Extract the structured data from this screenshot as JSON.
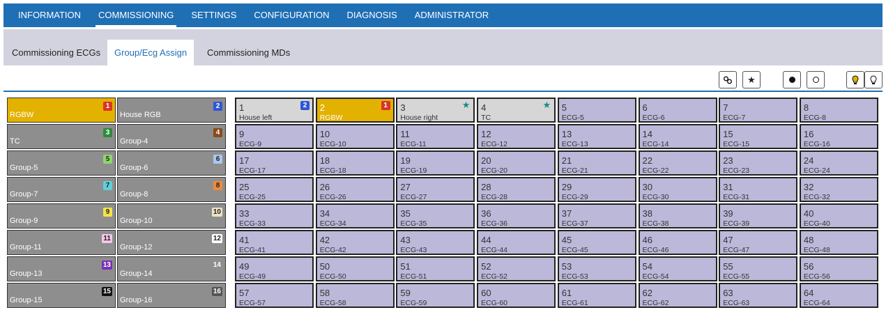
{
  "nav": {
    "items": [
      "INFORMATION",
      "COMMISSIONING",
      "SETTINGS",
      "CONFIGURATION",
      "DIAGNOSIS",
      "ADMINISTRATOR"
    ],
    "active": "COMMISSIONING"
  },
  "subtabs": {
    "items": [
      "Commissioning ECGs",
      "Group/Ecg Assign",
      "Commissioning MDs"
    ],
    "active": "Group/Ecg Assign"
  },
  "toolbar": {
    "buttons": [
      "link-icon",
      "star-icon",
      "filled-circle-icon",
      "hollow-circle-icon",
      "bulb-on-icon",
      "bulb-off-icon"
    ]
  },
  "groups": [
    {
      "label": "RGBW",
      "num": "1",
      "color": "#d9342b",
      "text_color": "#ffffff",
      "selected": true
    },
    {
      "label": "House RGB",
      "num": "2",
      "color": "#2f56d6",
      "text_color": "#ffffff"
    },
    {
      "label": "TC",
      "num": "3",
      "color": "#2e8b3a",
      "text_color": "#ffffff"
    },
    {
      "label": "Group-4",
      "num": "4",
      "color": "#8b4a1c",
      "text_color": "#ffffff"
    },
    {
      "label": "Group-5",
      "num": "5",
      "color": "#8fd66a",
      "text_color": "#222222"
    },
    {
      "label": "Group-6",
      "num": "6",
      "color": "#a9c8f0",
      "text_color": "#222222"
    },
    {
      "label": "Group-7",
      "num": "7",
      "color": "#5fd0d8",
      "text_color": "#222222"
    },
    {
      "label": "Group-8",
      "num": "8",
      "color": "#f08a3a",
      "text_color": "#222222"
    },
    {
      "label": "Group-9",
      "num": "9",
      "color": "#f5e24a",
      "text_color": "#222222"
    },
    {
      "label": "Group-10",
      "num": "10",
      "color": "#ede4c4",
      "text_color": "#222222"
    },
    {
      "label": "Group-11",
      "num": "11",
      "color": "#f3c6e6",
      "text_color": "#222222"
    },
    {
      "label": "Group-12",
      "num": "12",
      "color": "#ffffff",
      "text_color": "#222222"
    },
    {
      "label": "Group-13",
      "num": "13",
      "color": "#7a2fb8",
      "text_color": "#ffffff"
    },
    {
      "label": "Group-14",
      "num": "14",
      "color": "#8e8e8e",
      "text_color": "#ffffff"
    },
    {
      "label": "Group-15",
      "num": "15",
      "color": "#111111",
      "text_color": "#ffffff"
    },
    {
      "label": "Group-16",
      "num": "16",
      "color": "#555555",
      "text_color": "#ffffff"
    }
  ],
  "ecgs": [
    {
      "num": "1",
      "name": "House left",
      "badge": "2",
      "badge_color": "#2f56d6",
      "state": "named"
    },
    {
      "num": "2",
      "name": "RGBW",
      "badge": "1",
      "badge_color": "#d9342b",
      "state": "selected"
    },
    {
      "num": "3",
      "name": "House right",
      "star": true,
      "state": "named"
    },
    {
      "num": "4",
      "name": "TC",
      "star": true,
      "state": "named"
    },
    {
      "num": "5",
      "name": "ECG-5"
    },
    {
      "num": "6",
      "name": "ECG-6"
    },
    {
      "num": "7",
      "name": "ECG-7"
    },
    {
      "num": "8",
      "name": "ECG-8"
    },
    {
      "num": "9",
      "name": "ECG-9"
    },
    {
      "num": "10",
      "name": "ECG-10"
    },
    {
      "num": "11",
      "name": "ECG-11"
    },
    {
      "num": "12",
      "name": "ECG-12"
    },
    {
      "num": "13",
      "name": "ECG-13"
    },
    {
      "num": "14",
      "name": "ECG-14"
    },
    {
      "num": "15",
      "name": "ECG-15"
    },
    {
      "num": "16",
      "name": "ECG-16"
    },
    {
      "num": "17",
      "name": "ECG-17"
    },
    {
      "num": "18",
      "name": "ECG-18"
    },
    {
      "num": "19",
      "name": "ECG-19"
    },
    {
      "num": "20",
      "name": "ECG-20"
    },
    {
      "num": "21",
      "name": "ECG-21"
    },
    {
      "num": "22",
      "name": "ECG-22"
    },
    {
      "num": "23",
      "name": "ECG-23"
    },
    {
      "num": "24",
      "name": "ECG-24"
    },
    {
      "num": "25",
      "name": "ECG-25"
    },
    {
      "num": "26",
      "name": "ECG-26"
    },
    {
      "num": "27",
      "name": "ECG-27"
    },
    {
      "num": "28",
      "name": "ECG-28"
    },
    {
      "num": "29",
      "name": "ECG-29"
    },
    {
      "num": "30",
      "name": "ECG-30"
    },
    {
      "num": "31",
      "name": "ECG-31"
    },
    {
      "num": "32",
      "name": "ECG-32"
    },
    {
      "num": "33",
      "name": "ECG-33"
    },
    {
      "num": "34",
      "name": "ECG-34"
    },
    {
      "num": "35",
      "name": "ECG-35"
    },
    {
      "num": "36",
      "name": "ECG-36"
    },
    {
      "num": "37",
      "name": "ECG-37"
    },
    {
      "num": "38",
      "name": "ECG-38"
    },
    {
      "num": "39",
      "name": "ECG-39"
    },
    {
      "num": "40",
      "name": "ECG-40"
    },
    {
      "num": "41",
      "name": "ECG-41"
    },
    {
      "num": "42",
      "name": "ECG-42"
    },
    {
      "num": "43",
      "name": "ECG-43"
    },
    {
      "num": "44",
      "name": "ECG-44"
    },
    {
      "num": "45",
      "name": "ECG-45"
    },
    {
      "num": "46",
      "name": "ECG-46"
    },
    {
      "num": "47",
      "name": "ECG-47"
    },
    {
      "num": "48",
      "name": "ECG-48"
    },
    {
      "num": "49",
      "name": "ECG-49"
    },
    {
      "num": "50",
      "name": "ECG-50"
    },
    {
      "num": "51",
      "name": "ECG-51"
    },
    {
      "num": "52",
      "name": "ECG-52"
    },
    {
      "num": "53",
      "name": "ECG-53"
    },
    {
      "num": "54",
      "name": "ECG-54"
    },
    {
      "num": "55",
      "name": "ECG-55"
    },
    {
      "num": "56",
      "name": "ECG-56"
    },
    {
      "num": "57",
      "name": "ECG-57"
    },
    {
      "num": "58",
      "name": "ECG-58"
    },
    {
      "num": "59",
      "name": "ECG-59"
    },
    {
      "num": "60",
      "name": "ECG-60"
    },
    {
      "num": "61",
      "name": "ECG-61"
    },
    {
      "num": "62",
      "name": "ECG-62"
    },
    {
      "num": "63",
      "name": "ECG-63"
    },
    {
      "num": "64",
      "name": "ECG-64"
    }
  ]
}
